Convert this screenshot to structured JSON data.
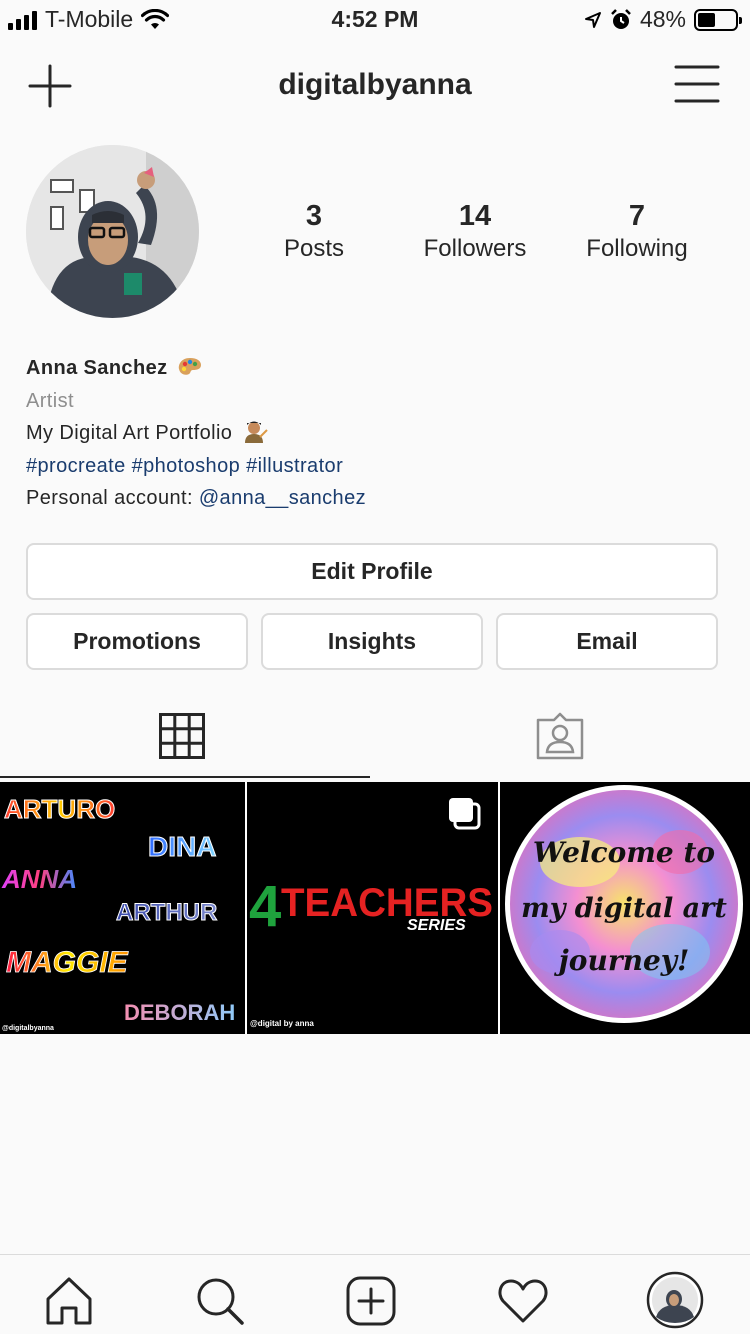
{
  "status_bar": {
    "carrier": "T-Mobile",
    "time": "4:52 PM",
    "battery": "48%",
    "battery_level": 0.48
  },
  "header": {
    "username": "digitalbyanna"
  },
  "profile": {
    "stats": [
      {
        "value": "3",
        "label": "Posts"
      },
      {
        "value": "14",
        "label": "Followers"
      },
      {
        "value": "7",
        "label": "Following"
      }
    ],
    "name": "Anna Sanchez",
    "category": "Artist",
    "bio_line": "My Digital Art Portfolio",
    "hashtags": "#procreate #photoshop #illustrator",
    "personal_prefix": "Personal account: ",
    "personal_handle": "@anna__sanchez"
  },
  "buttons": {
    "edit_profile": "Edit Profile",
    "promotions": "Promotions",
    "insights": "Insights",
    "email": "Email"
  },
  "posts": {
    "post1": {
      "names": [
        "ARTURO",
        "DINA",
        "ANNA",
        "ARTHUR",
        "MAGGIE",
        "DEBORAH"
      ],
      "credit": "@digitalbyanna"
    },
    "post2": {
      "number": "4",
      "title": "TEACHERS",
      "subtitle": "SERIES",
      "credit": "@digital by anna"
    },
    "post3": {
      "line1": "Welcome to",
      "line2": "my digital art",
      "line3": "journey!"
    }
  },
  "icons": {
    "header_left": "plus-icon",
    "header_right": "hamburger-menu-icon",
    "tab_grid": "grid-icon",
    "tab_tagged": "tagged-person-icon",
    "nav": [
      "home-icon",
      "search-icon",
      "new-post-icon",
      "heart-icon",
      "profile-avatar"
    ]
  },
  "colors": {
    "link": "#1a3c6e",
    "border": "#dbdbdb",
    "text": "#262626",
    "muted": "#8e8e8e"
  }
}
